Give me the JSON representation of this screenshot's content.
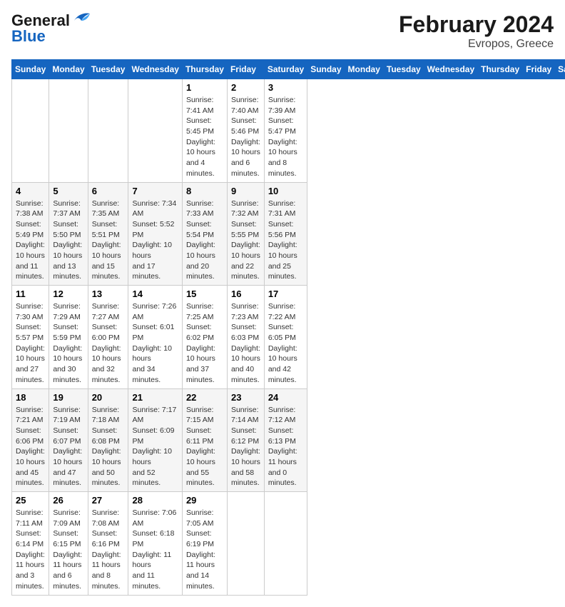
{
  "header": {
    "logo_line1": "General",
    "logo_line2": "Blue",
    "month_year": "February 2024",
    "location": "Evropos, Greece"
  },
  "columns": [
    "Sunday",
    "Monday",
    "Tuesday",
    "Wednesday",
    "Thursday",
    "Friday",
    "Saturday"
  ],
  "weeks": [
    [
      {
        "day": "",
        "detail": ""
      },
      {
        "day": "",
        "detail": ""
      },
      {
        "day": "",
        "detail": ""
      },
      {
        "day": "",
        "detail": ""
      },
      {
        "day": "1",
        "detail": "Sunrise: 7:41 AM\nSunset: 5:45 PM\nDaylight: 10 hours\nand 4 minutes."
      },
      {
        "day": "2",
        "detail": "Sunrise: 7:40 AM\nSunset: 5:46 PM\nDaylight: 10 hours\nand 6 minutes."
      },
      {
        "day": "3",
        "detail": "Sunrise: 7:39 AM\nSunset: 5:47 PM\nDaylight: 10 hours\nand 8 minutes."
      }
    ],
    [
      {
        "day": "4",
        "detail": "Sunrise: 7:38 AM\nSunset: 5:49 PM\nDaylight: 10 hours\nand 11 minutes."
      },
      {
        "day": "5",
        "detail": "Sunrise: 7:37 AM\nSunset: 5:50 PM\nDaylight: 10 hours\nand 13 minutes."
      },
      {
        "day": "6",
        "detail": "Sunrise: 7:35 AM\nSunset: 5:51 PM\nDaylight: 10 hours\nand 15 minutes."
      },
      {
        "day": "7",
        "detail": "Sunrise: 7:34 AM\nSunset: 5:52 PM\nDaylight: 10 hours\nand 17 minutes."
      },
      {
        "day": "8",
        "detail": "Sunrise: 7:33 AM\nSunset: 5:54 PM\nDaylight: 10 hours\nand 20 minutes."
      },
      {
        "day": "9",
        "detail": "Sunrise: 7:32 AM\nSunset: 5:55 PM\nDaylight: 10 hours\nand 22 minutes."
      },
      {
        "day": "10",
        "detail": "Sunrise: 7:31 AM\nSunset: 5:56 PM\nDaylight: 10 hours\nand 25 minutes."
      }
    ],
    [
      {
        "day": "11",
        "detail": "Sunrise: 7:30 AM\nSunset: 5:57 PM\nDaylight: 10 hours\nand 27 minutes."
      },
      {
        "day": "12",
        "detail": "Sunrise: 7:29 AM\nSunset: 5:59 PM\nDaylight: 10 hours\nand 30 minutes."
      },
      {
        "day": "13",
        "detail": "Sunrise: 7:27 AM\nSunset: 6:00 PM\nDaylight: 10 hours\nand 32 minutes."
      },
      {
        "day": "14",
        "detail": "Sunrise: 7:26 AM\nSunset: 6:01 PM\nDaylight: 10 hours\nand 34 minutes."
      },
      {
        "day": "15",
        "detail": "Sunrise: 7:25 AM\nSunset: 6:02 PM\nDaylight: 10 hours\nand 37 minutes."
      },
      {
        "day": "16",
        "detail": "Sunrise: 7:23 AM\nSunset: 6:03 PM\nDaylight: 10 hours\nand 40 minutes."
      },
      {
        "day": "17",
        "detail": "Sunrise: 7:22 AM\nSunset: 6:05 PM\nDaylight: 10 hours\nand 42 minutes."
      }
    ],
    [
      {
        "day": "18",
        "detail": "Sunrise: 7:21 AM\nSunset: 6:06 PM\nDaylight: 10 hours\nand 45 minutes."
      },
      {
        "day": "19",
        "detail": "Sunrise: 7:19 AM\nSunset: 6:07 PM\nDaylight: 10 hours\nand 47 minutes."
      },
      {
        "day": "20",
        "detail": "Sunrise: 7:18 AM\nSunset: 6:08 PM\nDaylight: 10 hours\nand 50 minutes."
      },
      {
        "day": "21",
        "detail": "Sunrise: 7:17 AM\nSunset: 6:09 PM\nDaylight: 10 hours\nand 52 minutes."
      },
      {
        "day": "22",
        "detail": "Sunrise: 7:15 AM\nSunset: 6:11 PM\nDaylight: 10 hours\nand 55 minutes."
      },
      {
        "day": "23",
        "detail": "Sunrise: 7:14 AM\nSunset: 6:12 PM\nDaylight: 10 hours\nand 58 minutes."
      },
      {
        "day": "24",
        "detail": "Sunrise: 7:12 AM\nSunset: 6:13 PM\nDaylight: 11 hours\nand 0 minutes."
      }
    ],
    [
      {
        "day": "25",
        "detail": "Sunrise: 7:11 AM\nSunset: 6:14 PM\nDaylight: 11 hours\nand 3 minutes."
      },
      {
        "day": "26",
        "detail": "Sunrise: 7:09 AM\nSunset: 6:15 PM\nDaylight: 11 hours\nand 6 minutes."
      },
      {
        "day": "27",
        "detail": "Sunrise: 7:08 AM\nSunset: 6:16 PM\nDaylight: 11 hours\nand 8 minutes."
      },
      {
        "day": "28",
        "detail": "Sunrise: 7:06 AM\nSunset: 6:18 PM\nDaylight: 11 hours\nand 11 minutes."
      },
      {
        "day": "29",
        "detail": "Sunrise: 7:05 AM\nSunset: 6:19 PM\nDaylight: 11 hours\nand 14 minutes."
      },
      {
        "day": "",
        "detail": ""
      },
      {
        "day": "",
        "detail": ""
      }
    ]
  ]
}
